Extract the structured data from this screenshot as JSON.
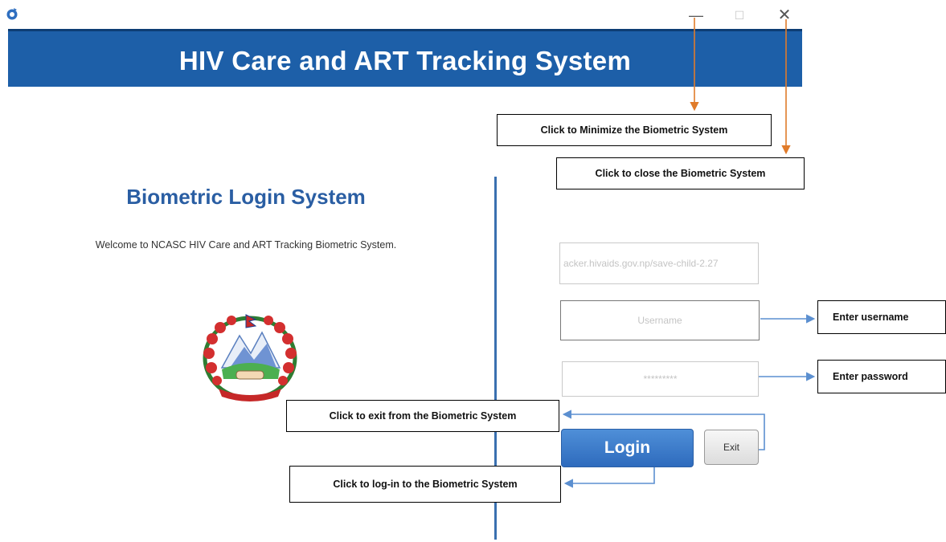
{
  "window": {
    "minimize_glyph": "—",
    "maximize_glyph": "☐",
    "close_glyph": "✕",
    "app_icon": "app-logo-icon"
  },
  "header": {
    "title": "HIV Care and ART Tracking System",
    "background": "#1d5fa8"
  },
  "left_panel": {
    "heading": "Biometric Login System",
    "welcome": "Welcome to NCASC HIV Care and ART Tracking Biometric System.",
    "emblem_icon": "nepal-government-emblem-icon"
  },
  "form": {
    "server_url": "acker.hivaids.gov.np/save-child-2.27",
    "username_placeholder": "Username",
    "password_placeholder": "*********",
    "login_label": "Login",
    "exit_label": "Exit"
  },
  "callouts": {
    "minimize": "Click to Minimize the Biometric System",
    "close": "Click to close the Biometric System",
    "username": "Enter username",
    "password": "Enter password",
    "exit": "Click to exit from the Biometric System",
    "login": "Click to log-in to the Biometric System"
  },
  "colors": {
    "accent": "#2a5ea3",
    "callout_arrow_orange": "#e07b2a",
    "callout_arrow_blue": "#5b8fd0"
  }
}
